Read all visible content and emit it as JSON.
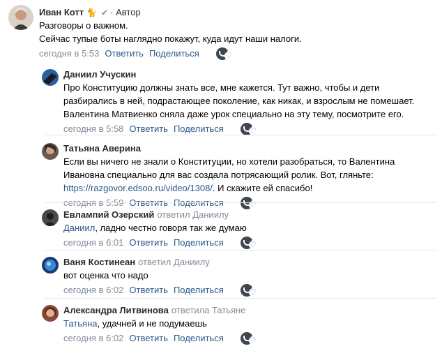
{
  "root": {
    "author": "Иван Котт",
    "badge": "· Автор",
    "lines": [
      "Разговоры о важном.",
      "Сейчас тупые боты наглядно покажут, куда идут наши налоги."
    ],
    "time": "сегодня в 5:53",
    "reply": "Ответить",
    "share": "Поделиться"
  },
  "replies": [
    {
      "author": "Даниил Учускин",
      "lines": [
        "Про Конституцию должны знать все, мне кажется. Тут важно, чтобы и дети",
        "разбирались в ней, подрастающее поколение, как никак, и взрослым не помешает.",
        "Валентина Матвиенко сняла даже урок специально на эту тему, посмотрите его."
      ],
      "time": "сегодня в 5:58",
      "reply": "Ответить",
      "share": "Поделиться"
    },
    {
      "author": "Татьяна Аверина",
      "lines": [
        "Если вы ничего не знали о Конституции, но хотели разобраться, то Валентина",
        "Ивановна специально для вас создала потрясающий ролик. Вот, гляньте:"
      ],
      "link": "https://razgovor.edsoo.ru/video/1308/",
      "after_link": ". И скажите ей спасибо!",
      "time": "сегодня в 5:59",
      "reply": "Ответить",
      "share": "Поделиться"
    },
    {
      "author": "Евлампий Озерский",
      "replied": "ответил Даниилу",
      "mention": "Даниил",
      "text": ", ладно честно говоря так же думаю",
      "time": "сегодня в 6:01",
      "reply": "Ответить",
      "share": "Поделиться"
    },
    {
      "author": "Ваня Костинеан",
      "replied": "ответил Даниилу",
      "text": "вот оценка что надо",
      "time": "сегодня в 6:02",
      "reply": "Ответить",
      "share": "Поделиться"
    },
    {
      "author": "Александра Литвинова",
      "replied": "ответила Татьяне",
      "mention": "Татьяна",
      "text": ", удачней и не подумаешь",
      "time": "сегодня в 6:02",
      "reply": "Ответить",
      "share": "Поделиться"
    }
  ]
}
